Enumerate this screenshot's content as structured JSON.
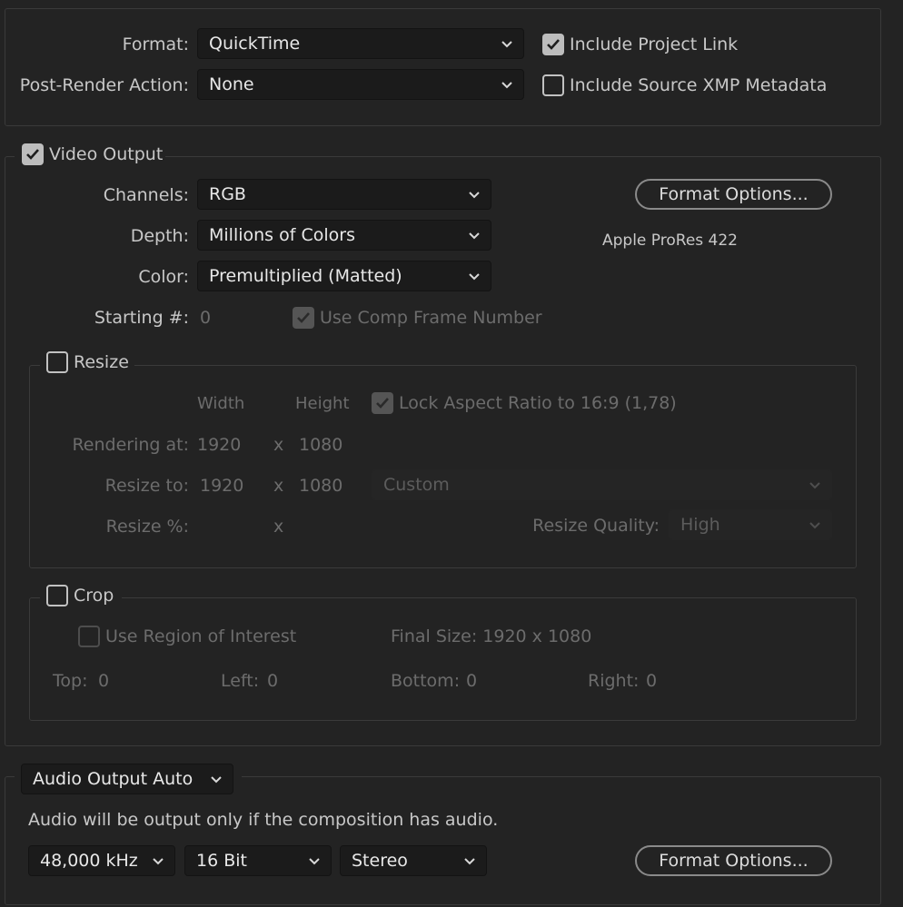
{
  "top": {
    "format_label": "Format:",
    "format_value": "QuickTime",
    "post_render_label": "Post-Render Action:",
    "post_render_value": "None",
    "include_project_link": "Include Project Link",
    "include_source_xmp": "Include Source XMP Metadata"
  },
  "video": {
    "section_label": "Video Output",
    "channels_label": "Channels:",
    "channels_value": "RGB",
    "depth_label": "Depth:",
    "depth_value": "Millions of Colors",
    "color_label": "Color:",
    "color_value": "Premultiplied (Matted)",
    "starting_label": "Starting #:",
    "starting_value": "0",
    "use_comp_frame": "Use Comp Frame Number",
    "format_options": "Format Options...",
    "codec": "Apple ProRes 422"
  },
  "resize": {
    "section_label": "Resize",
    "width_header": "Width",
    "height_header": "Height",
    "lock_aspect": "Lock Aspect Ratio to 16:9 (1,78)",
    "rendering_at_label": "Rendering at:",
    "rendering_w": "1920",
    "rendering_h": "1080",
    "resize_to_label": "Resize to:",
    "resize_to_w": "1920",
    "resize_to_h": "1080",
    "preset_value": "Custom",
    "resize_pct_label": "Resize %:",
    "x": "x",
    "quality_label": "Resize Quality:",
    "quality_value": "High"
  },
  "crop": {
    "section_label": "Crop",
    "use_roi": "Use Region of Interest",
    "final_size": "Final Size: 1920 x 1080",
    "top_label": "Top:",
    "top_value": "0",
    "left_label": "Left:",
    "left_value": "0",
    "bottom_label": "Bottom:",
    "bottom_value": "0",
    "right_label": "Right:",
    "right_value": "0"
  },
  "audio": {
    "mode_value": "Audio Output Auto",
    "note": "Audio will be output only if the composition has audio.",
    "rate_value": "48,000 kHz",
    "depth_value": "16 Bit",
    "channels_value": "Stereo",
    "format_options": "Format Options..."
  },
  "icons": {
    "check": "checkmark-icon",
    "chevron": "chevron-down-icon"
  }
}
